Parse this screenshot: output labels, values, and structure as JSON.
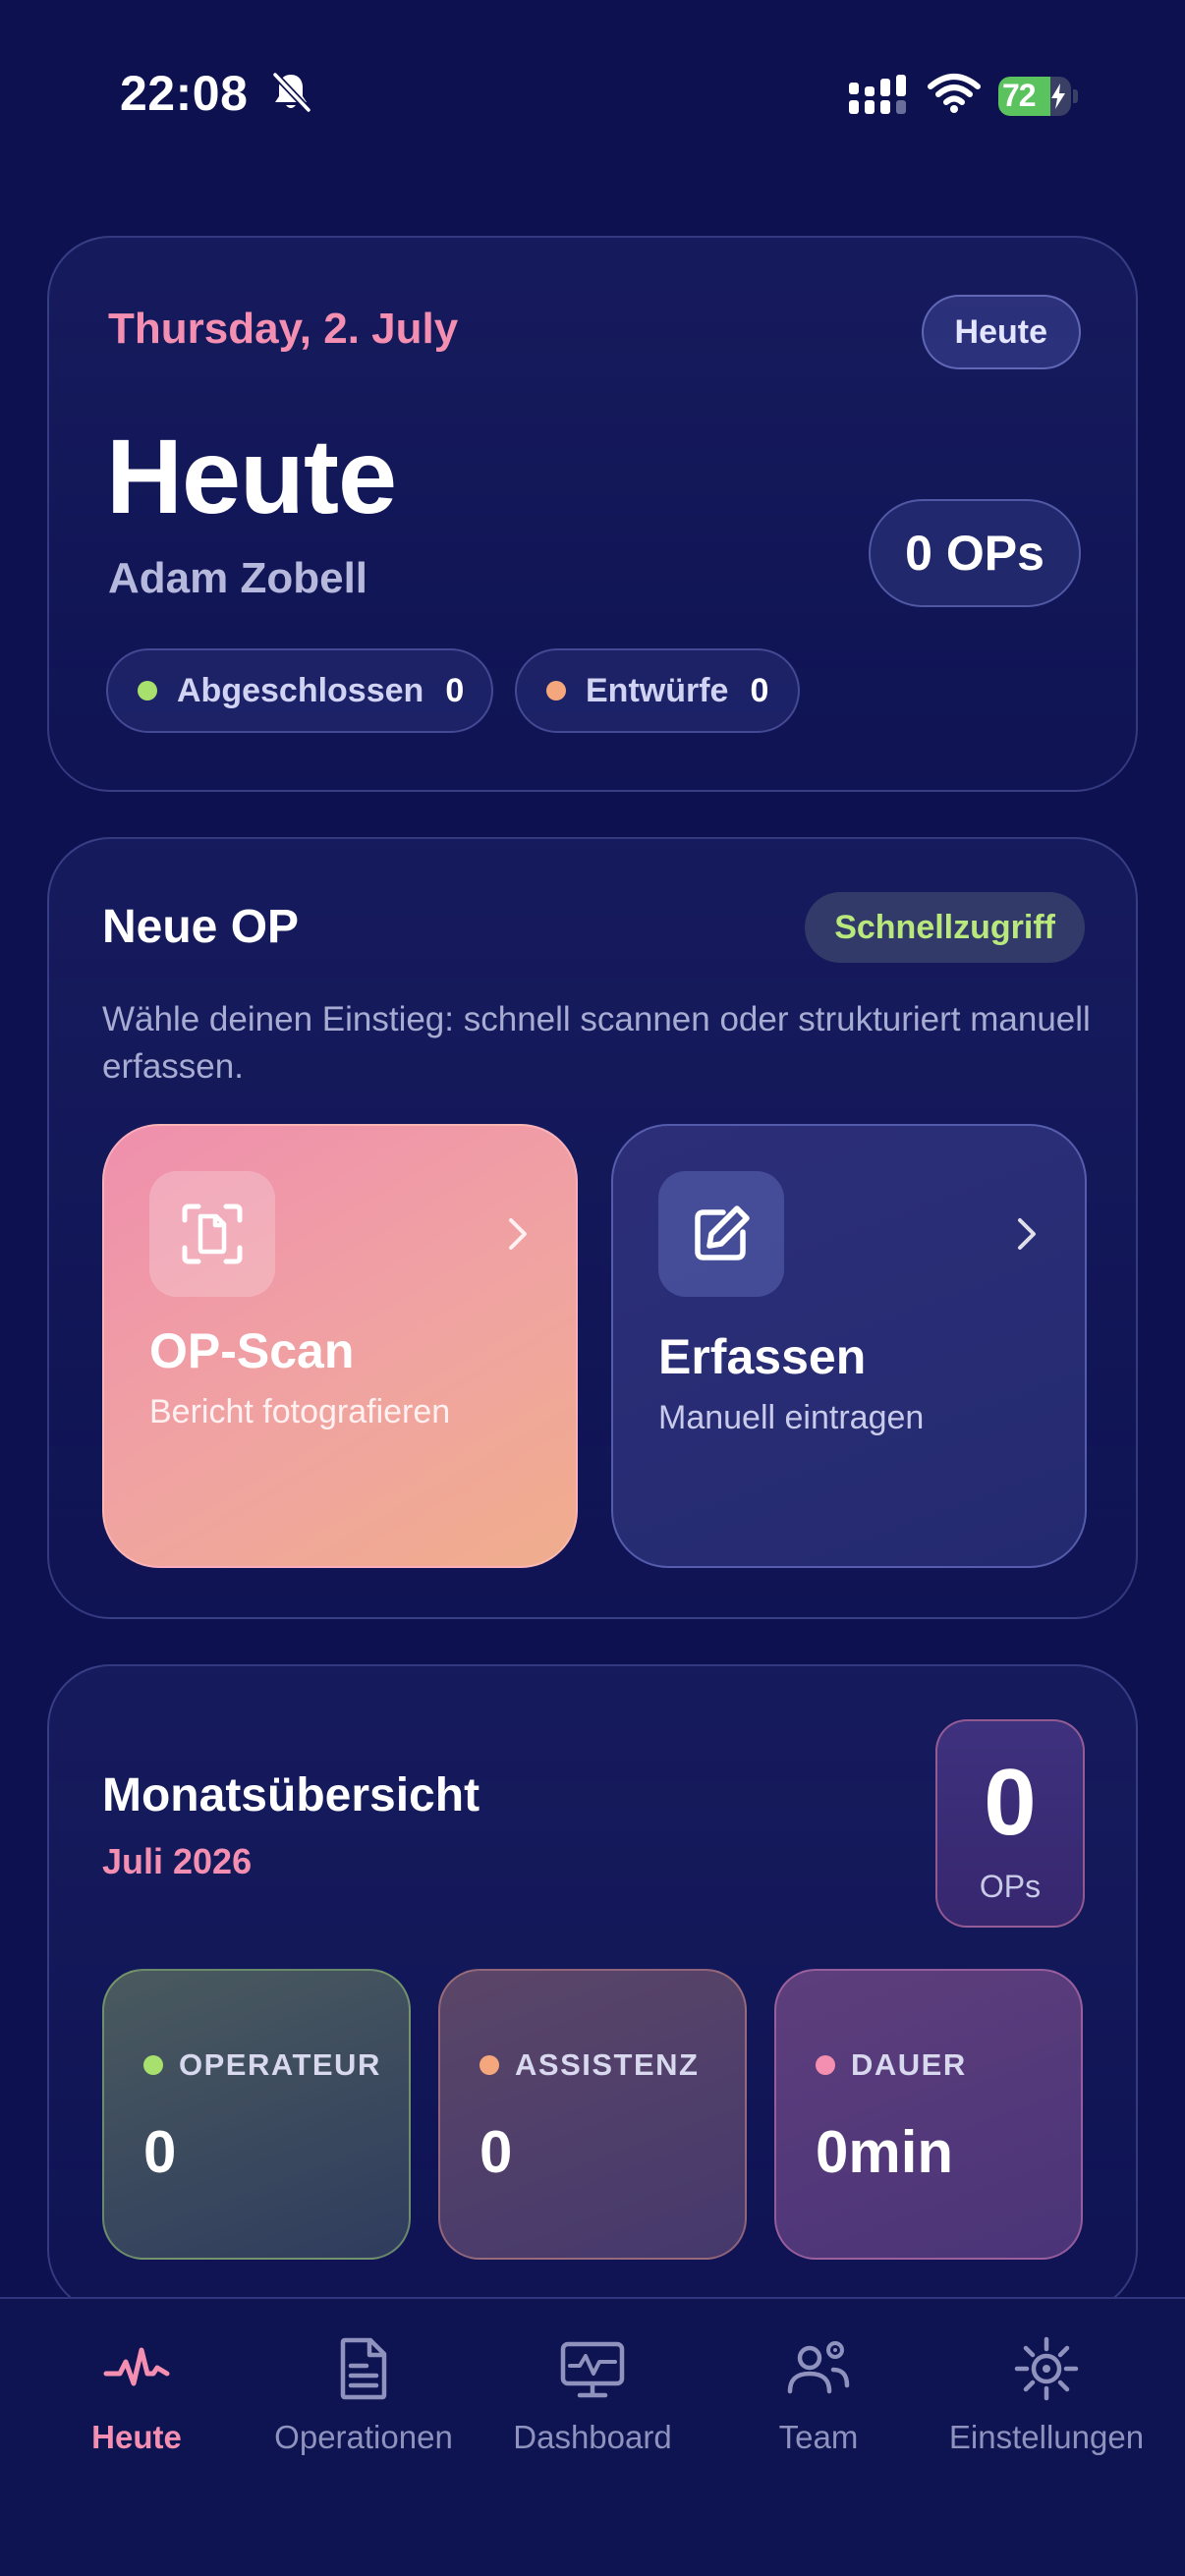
{
  "status_bar": {
    "time": "22:08",
    "battery": "72",
    "battery_level": 0.72
  },
  "today_card": {
    "date": "Thursday, 2. July",
    "chip": "Heute",
    "title": "Heute",
    "user": "Adam Zobell",
    "ops": "0 OPs",
    "completed_label": "Abgeschlossen",
    "completed_count": "0",
    "drafts_label": "Entwürfe",
    "drafts_count": "0"
  },
  "new_op": {
    "title": "Neue OP",
    "chip": "Schnellzugriff",
    "description": "Wähle deinen Einstieg: schnell scannen oder strukturiert manuell erfassen.",
    "scan": {
      "title": "OP-Scan",
      "subtitle": "Bericht fotografieren",
      "icon": "document-scan-icon"
    },
    "entry": {
      "title": "Erfassen",
      "subtitle": "Manuell eintragen",
      "icon": "edit-icon"
    }
  },
  "month": {
    "title": "Monatsübersicht",
    "subtitle": "Juli 2026",
    "count": "0",
    "count_label": "OPs",
    "metrics": [
      {
        "label": "OPERATEUR",
        "value": "0",
        "color": "#a8e06e"
      },
      {
        "label": "ASSISTENZ",
        "value": "0",
        "color": "#f4a77c"
      },
      {
        "label": "DAUER",
        "value": "0min",
        "color": "#f48fb1"
      }
    ]
  },
  "tabs": [
    {
      "label": "Heute",
      "icon": "pulse-icon",
      "active": true
    },
    {
      "label": "Operationen",
      "icon": "document-icon",
      "active": false
    },
    {
      "label": "Dashboard",
      "icon": "monitor-icon",
      "active": false
    },
    {
      "label": "Team",
      "icon": "team-icon",
      "active": false
    },
    {
      "label": "Einstellungen",
      "icon": "settings-icon",
      "active": false
    }
  ],
  "colors": {
    "background": "#0d1150",
    "accent_pink": "#f48fb1",
    "accent_green": "#a8e06e",
    "accent_orange": "#f4a77c"
  }
}
